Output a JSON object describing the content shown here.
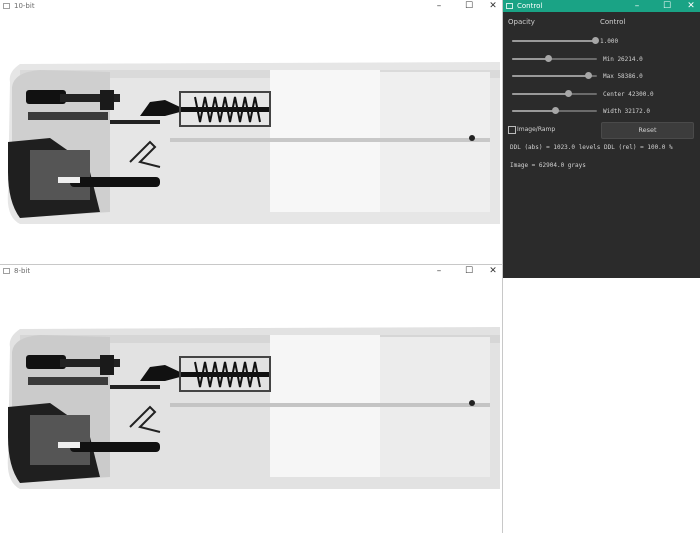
{
  "windows": {
    "top": {
      "title": "10-bit"
    },
    "bottom": {
      "title": "8-bit"
    },
    "control": {
      "title": "Control",
      "headers": {
        "opacity": "Opacity",
        "control": "Control"
      },
      "sliders": [
        {
          "id": "opacity",
          "label": "1.000",
          "level": 0.98
        },
        {
          "id": "min",
          "label": "Min 26214.0",
          "level": 0.42
        },
        {
          "id": "max",
          "label": "Max 58386.0",
          "level": 0.89
        },
        {
          "id": "center",
          "label": "Center 42300.0",
          "level": 0.66
        },
        {
          "id": "width",
          "label": "Width 32172.0",
          "level": 0.5
        }
      ],
      "checkbox_label": "Image/Ramp",
      "checkbox_checked": false,
      "reset_label": "Reset",
      "ddl_abs": "DDL (abs) = 1023.0 levels",
      "ddl_rel": "DDL (rel) = 100.0 %",
      "image_info": "Image = 62904.0 grays"
    }
  },
  "icons": {
    "minimize": "minimize-icon",
    "maximize": "maximize-icon",
    "close": "close-icon",
    "app": "app-icon"
  },
  "colors": {
    "control_titlebar": "#1aa385",
    "control_bg": "#2b2b2b"
  }
}
